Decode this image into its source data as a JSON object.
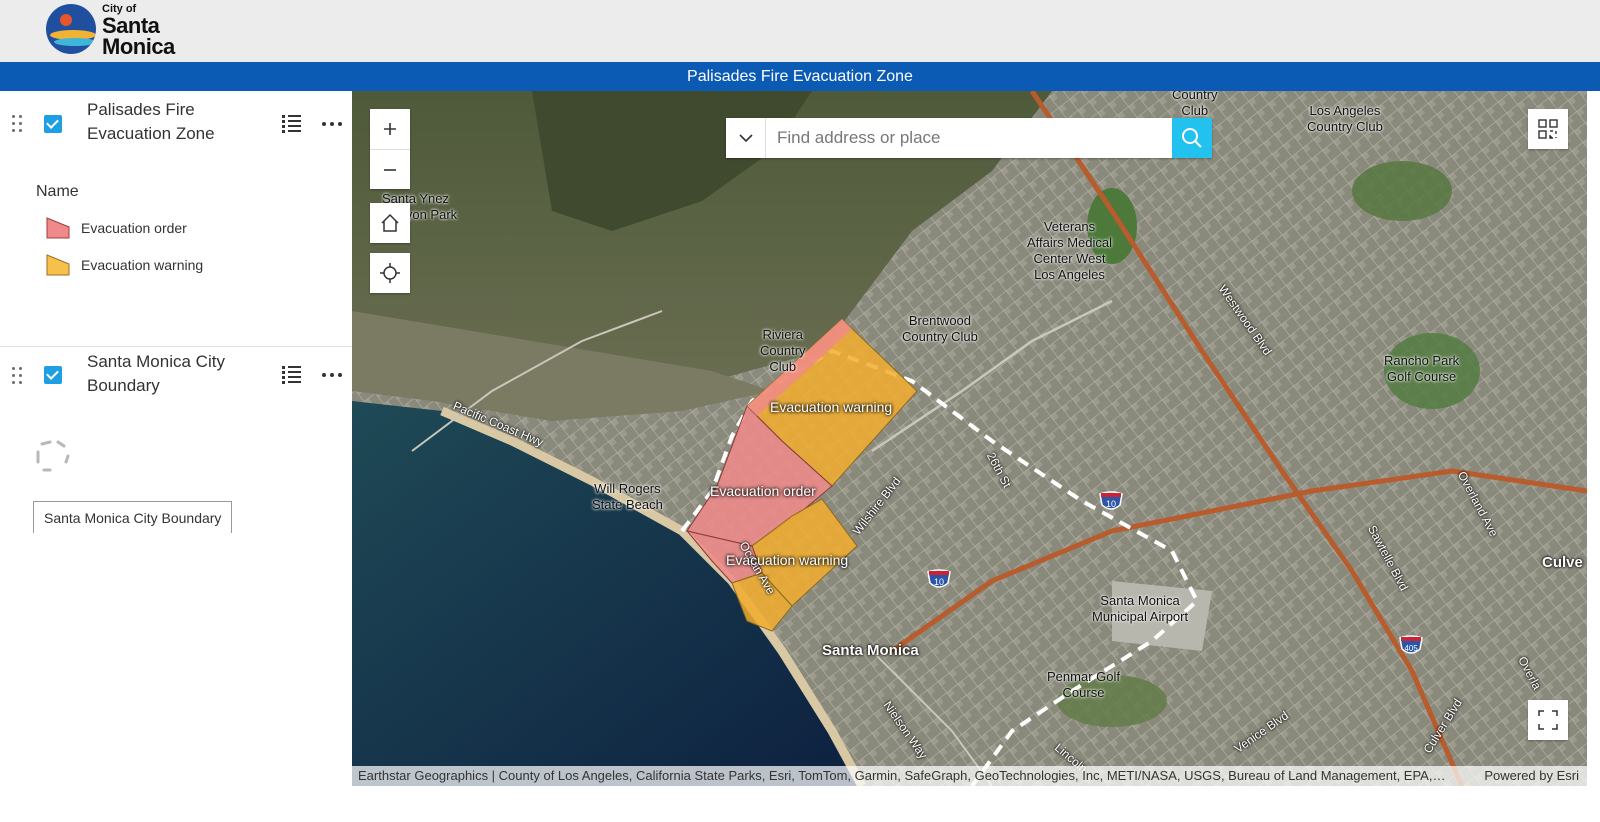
{
  "header": {
    "logo_small": "City of",
    "logo_line1": "Santa",
    "logo_line2": "Monica",
    "title": "Palisades Fire Evacuation Zone"
  },
  "layers": [
    {
      "title": "Palisades Fire Evacuation Zone",
      "visible": true,
      "legend_heading": "Name",
      "legend": [
        {
          "label": "Evacuation order",
          "color": "#f08a8a"
        },
        {
          "label": "Evacuation warning",
          "color": "#f7c04a"
        }
      ]
    },
    {
      "title": "Santa Monica City Boundary",
      "visible": true,
      "loading": true,
      "tooltip": "Santa Monica City Boundary"
    }
  ],
  "map": {
    "search_placeholder": "Find address or place",
    "labels": {
      "santa_ynez": "Santa Ynez\nCanyon Park",
      "country_club_top": "Country\nClub",
      "la_country_club": "Los Angeles\nCountry Club",
      "veterans": "Veterans\nAffairs Medical\nCenter West\nLos Angeles",
      "brentwood": "Brentwood\nCountry Club",
      "riviera": "Riviera\nCountry\nClub",
      "pch": "Pacific Coast Hwy",
      "will_rogers": "Will Rogers\nState Beach",
      "westwood": "Westwood Blvd",
      "rancho": "Rancho Park\nGolf Course",
      "sawtelle": "Sawtelle Blvd",
      "overland": "Overland Ave",
      "culver": "Culve",
      "wilshire": "Wilshire Blvd",
      "st26": "26th St",
      "ocean": "Ocean Ave",
      "santa_monica": "Santa Monica",
      "smo_airport": "Santa Monica\nMunicipal Airport",
      "penmar": "Penmar Golf\nCourse",
      "nielson": "Nielson Way",
      "venice": "Venice Blvd",
      "culver_blvd": "Culver Blvd",
      "overland2": "Overla",
      "lincoln": "Lincoln"
    },
    "zones": {
      "warning_north": "Evacuation warning",
      "order": "Evacuation order",
      "warning_south": "Evacuation warning"
    },
    "shields": {
      "i10a": "10",
      "i10b": "10",
      "i405": "405"
    },
    "attribution": "Earthstar Geographics | County of Los Angeles, California State Parks, Esri, TomTom, Garmin, SafeGraph, GeoTechnologies, Inc, METI/NASA, USGS, Bureau of Land Management, EPA, NPS, US Census Bureau, USDA, USFWS",
    "powered_by": "Powered by Esri"
  }
}
